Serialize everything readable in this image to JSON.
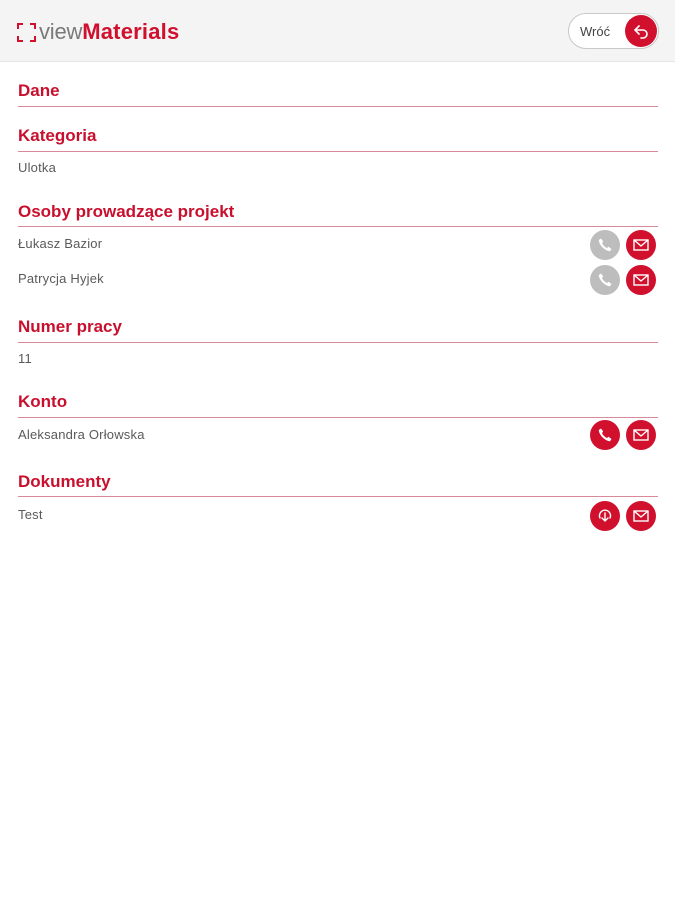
{
  "header": {
    "logo_view": "view",
    "logo_materials": "Materials",
    "back_label": "Wróć"
  },
  "sections": {
    "dane": {
      "title": "Dane"
    },
    "kategoria": {
      "title": "Kategoria",
      "value": "Ulotka"
    },
    "osoby": {
      "title": "Osoby prowadzące projekt",
      "people": [
        {
          "name": "Łukasz Bazior",
          "phone_enabled": false
        },
        {
          "name": "Patrycja Hyjek",
          "phone_enabled": false
        }
      ]
    },
    "numer": {
      "title": "Numer pracy",
      "value": "11"
    },
    "konto": {
      "title": "Konto",
      "name": "Aleksandra Orłowska",
      "phone_enabled": true
    },
    "dokumenty": {
      "title": "Dokumenty",
      "name": "Test"
    }
  },
  "colors": {
    "accent": "#d0102d",
    "disabled": "#bdbdbd",
    "header_bg": "#f4f4f4"
  },
  "icons": {
    "back": "back-arrow-icon",
    "phone": "phone-icon",
    "mail": "envelope-icon",
    "download": "download-icon"
  }
}
